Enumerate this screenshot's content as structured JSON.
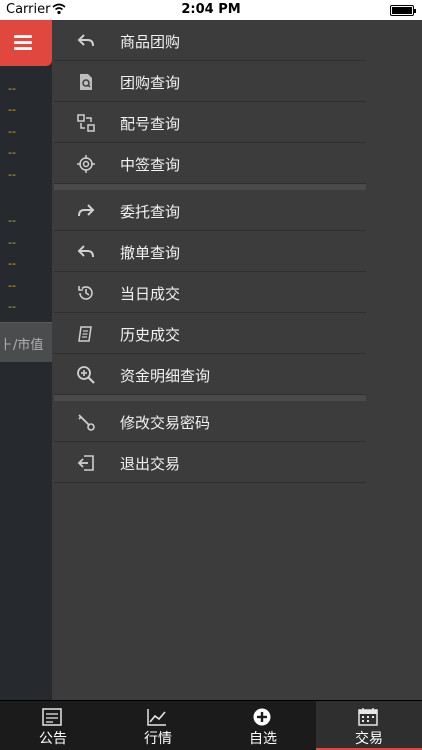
{
  "status_bar": {
    "carrier": "Carrier",
    "time": "2:04 PM"
  },
  "left_panel": {
    "dashes": [
      "--",
      "--",
      "--",
      "--",
      "--",
      "--",
      "--",
      "--",
      "--",
      "--"
    ],
    "market_value_fragment": "⺊/市值"
  },
  "menu": {
    "group1": [
      {
        "label": "商品团购",
        "icon": "reply-icon"
      },
      {
        "label": "团购查询",
        "icon": "document-search-icon"
      },
      {
        "label": "配号查询",
        "icon": "number-match-icon"
      },
      {
        "label": "中签查询",
        "icon": "target-icon"
      }
    ],
    "group2": [
      {
        "label": "委托查询",
        "icon": "forward-icon"
      },
      {
        "label": "撤单查询",
        "icon": "undo-icon"
      },
      {
        "label": "当日成交",
        "icon": "history-icon"
      },
      {
        "label": "历史成交",
        "icon": "receipt-icon"
      },
      {
        "label": "资金明细查询",
        "icon": "zoom-in-icon"
      }
    ],
    "group3": [
      {
        "label": "修改交易密码",
        "icon": "key-icon"
      },
      {
        "label": "退出交易",
        "icon": "logout-icon"
      }
    ]
  },
  "tabbar": {
    "tabs": [
      {
        "label": "公告",
        "icon": "announcement-icon",
        "active": false
      },
      {
        "label": "行情",
        "icon": "chart-icon",
        "active": false
      },
      {
        "label": "自选",
        "icon": "add-circle-icon",
        "active": false
      },
      {
        "label": "交易",
        "icon": "calendar-icon",
        "active": true
      }
    ]
  },
  "colors": {
    "accent": "#e0473e",
    "menu_bg": "#3c3c3c",
    "left_panel_bg": "#262a2e",
    "dash_color": "#d9b21a"
  }
}
